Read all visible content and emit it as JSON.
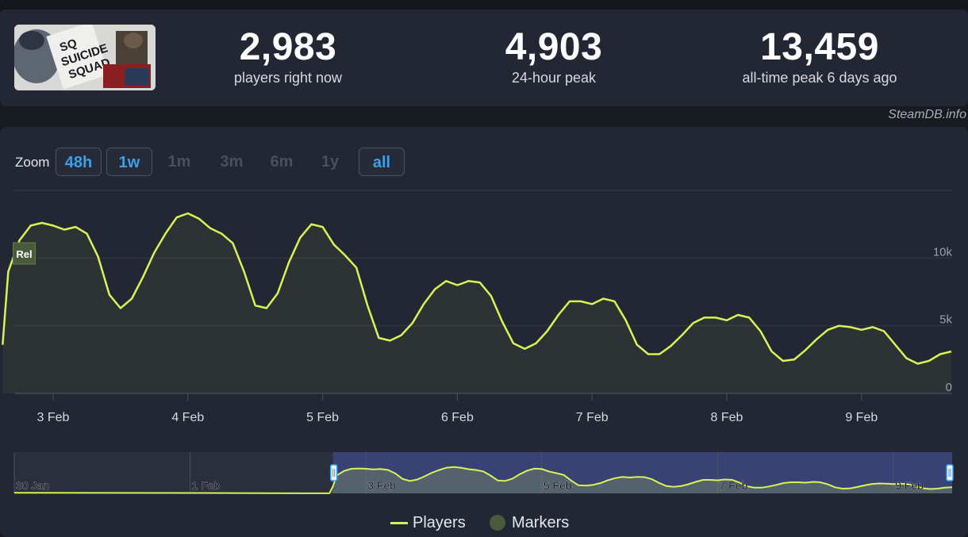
{
  "stats": [
    {
      "value": "2,983",
      "label": "players right now"
    },
    {
      "value": "4,903",
      "label": "24-hour peak"
    },
    {
      "value": "13,459",
      "label": "all-time peak 6 days ago"
    }
  ],
  "credit": "SteamDB.info",
  "zoom": {
    "label": "Zoom",
    "buttons": [
      {
        "label": "48h",
        "state": "active"
      },
      {
        "label": "1w",
        "state": "active"
      },
      {
        "label": "1m",
        "state": "disabled"
      },
      {
        "label": "3m",
        "state": "disabled"
      },
      {
        "label": "6m",
        "state": "disabled"
      },
      {
        "label": "1y",
        "state": "disabled"
      },
      {
        "label": "all",
        "state": "active"
      }
    ]
  },
  "marker_label": "Rel",
  "legend": {
    "players": "Players",
    "markers": "Markers"
  },
  "colors": {
    "players_line": "#d9f255",
    "marker": "#4a5a3c",
    "navigator_selection": "#3d4a8a",
    "accent": "#3d9fe8"
  },
  "chart_data": {
    "type": "line",
    "x_axis": "date",
    "ylim": [
      0,
      15000
    ],
    "yticks": [
      {
        "value": 0,
        "label": "0"
      },
      {
        "value": 5000,
        "label": "5k"
      },
      {
        "value": 10000,
        "label": "10k"
      }
    ],
    "xticks": [
      "3 Feb",
      "4 Feb",
      "5 Feb",
      "6 Feb",
      "7 Feb",
      "8 Feb",
      "9 Feb"
    ],
    "grid": true,
    "series": [
      {
        "name": "Players",
        "points": [
          [
            "2 Feb 15:00",
            3600
          ],
          [
            "2 Feb 16:00",
            9000
          ],
          [
            "2 Feb 18:00",
            11300
          ],
          [
            "2 Feb 20:00",
            12400
          ],
          [
            "2 Feb 22:00",
            12600
          ],
          [
            "3 Feb 00:00",
            12400
          ],
          [
            "3 Feb 02:00",
            12100
          ],
          [
            "3 Feb 04:00",
            12300
          ],
          [
            "3 Feb 06:00",
            11800
          ],
          [
            "3 Feb 08:00",
            10100
          ],
          [
            "3 Feb 10:00",
            7300
          ],
          [
            "3 Feb 12:00",
            6300
          ],
          [
            "3 Feb 14:00",
            7000
          ],
          [
            "3 Feb 16:00",
            8600
          ],
          [
            "3 Feb 18:00",
            10400
          ],
          [
            "3 Feb 20:00",
            11800
          ],
          [
            "3 Feb 22:00",
            13000
          ],
          [
            "4 Feb 00:00",
            13300
          ],
          [
            "4 Feb 02:00",
            12900
          ],
          [
            "4 Feb 04:00",
            12200
          ],
          [
            "4 Feb 06:00",
            11800
          ],
          [
            "4 Feb 08:00",
            11100
          ],
          [
            "4 Feb 10:00",
            9000
          ],
          [
            "4 Feb 12:00",
            6500
          ],
          [
            "4 Feb 14:00",
            6300
          ],
          [
            "4 Feb 16:00",
            7400
          ],
          [
            "4 Feb 18:00",
            9700
          ],
          [
            "4 Feb 20:00",
            11500
          ],
          [
            "4 Feb 22:00",
            12500
          ],
          [
            "5 Feb 00:00",
            12300
          ],
          [
            "5 Feb 02:00",
            11000
          ],
          [
            "5 Feb 04:00",
            10200
          ],
          [
            "5 Feb 06:00",
            9300
          ],
          [
            "5 Feb 08:00",
            6500
          ],
          [
            "5 Feb 10:00",
            4100
          ],
          [
            "5 Feb 12:00",
            3900
          ],
          [
            "5 Feb 14:00",
            4300
          ],
          [
            "5 Feb 16:00",
            5200
          ],
          [
            "5 Feb 18:00",
            6600
          ],
          [
            "5 Feb 20:00",
            7700
          ],
          [
            "5 Feb 22:00",
            8300
          ],
          [
            "6 Feb 00:00",
            8000
          ],
          [
            "6 Feb 02:00",
            8300
          ],
          [
            "6 Feb 04:00",
            8200
          ],
          [
            "6 Feb 06:00",
            7200
          ],
          [
            "6 Feb 08:00",
            5300
          ],
          [
            "6 Feb 10:00",
            3700
          ],
          [
            "6 Feb 12:00",
            3300
          ],
          [
            "6 Feb 14:00",
            3700
          ],
          [
            "6 Feb 16:00",
            4600
          ],
          [
            "6 Feb 18:00",
            5800
          ],
          [
            "6 Feb 20:00",
            6800
          ],
          [
            "6 Feb 22:00",
            6800
          ],
          [
            "7 Feb 00:00",
            6600
          ],
          [
            "7 Feb 02:00",
            7000
          ],
          [
            "7 Feb 04:00",
            6800
          ],
          [
            "7 Feb 06:00",
            5400
          ],
          [
            "7 Feb 08:00",
            3600
          ],
          [
            "7 Feb 10:00",
            2900
          ],
          [
            "7 Feb 12:00",
            2900
          ],
          [
            "7 Feb 14:00",
            3500
          ],
          [
            "7 Feb 16:00",
            4300
          ],
          [
            "7 Feb 18:00",
            5200
          ],
          [
            "7 Feb 20:00",
            5600
          ],
          [
            "7 Feb 22:00",
            5600
          ],
          [
            "8 Feb 00:00",
            5400
          ],
          [
            "8 Feb 02:00",
            5800
          ],
          [
            "8 Feb 04:00",
            5600
          ],
          [
            "8 Feb 06:00",
            4600
          ],
          [
            "8 Feb 08:00",
            3100
          ],
          [
            "8 Feb 10:00",
            2400
          ],
          [
            "8 Feb 12:00",
            2500
          ],
          [
            "8 Feb 14:00",
            3200
          ],
          [
            "8 Feb 16:00",
            4000
          ],
          [
            "8 Feb 18:00",
            4700
          ],
          [
            "8 Feb 20:00",
            5000
          ],
          [
            "8 Feb 22:00",
            4900
          ],
          [
            "9 Feb 00:00",
            4700
          ],
          [
            "9 Feb 02:00",
            4900
          ],
          [
            "9 Feb 04:00",
            4600
          ],
          [
            "9 Feb 06:00",
            3600
          ],
          [
            "9 Feb 08:00",
            2600
          ],
          [
            "9 Feb 10:00",
            2200
          ],
          [
            "9 Feb 12:00",
            2400
          ],
          [
            "9 Feb 14:00",
            2900
          ],
          [
            "9 Feb 16:00",
            3100
          ]
        ]
      }
    ],
    "markers": [
      {
        "date": "2 Feb 17:00",
        "label": "Rel"
      }
    ],
    "navigator": {
      "xticks": [
        "30 Jan",
        "1 Feb",
        "3 Feb",
        "5 Feb",
        "7 Feb",
        "9 Feb"
      ],
      "selection": [
        "2 Feb 15:00",
        "9 Feb 16:00"
      ]
    },
    "legend_position": "bottom"
  }
}
